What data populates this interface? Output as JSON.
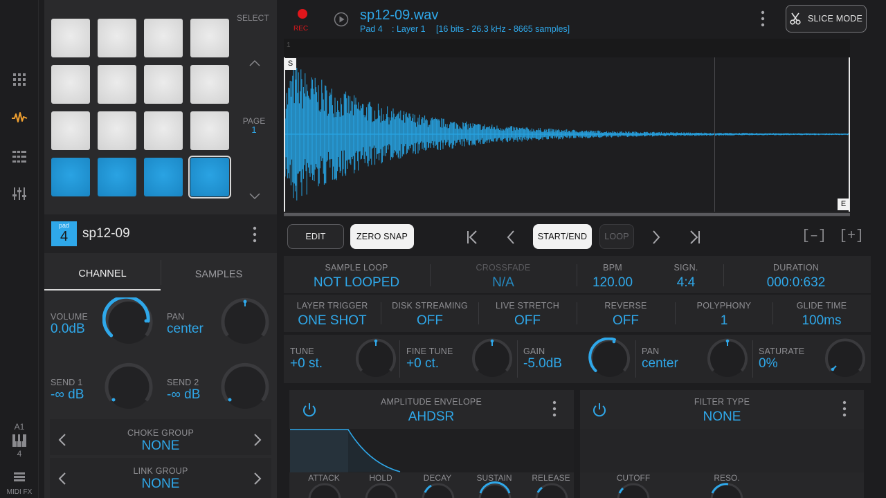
{
  "header": {
    "rec_label": "REC",
    "file_name": "sp12-09.wav",
    "pad_info": "Pad 4",
    "layer_info": ": Layer 1",
    "sample_info": "[16 bits - 26.3 kHz - 8665 samples]",
    "slice_mode_label": "SLICE MODE"
  },
  "pad_grid": {
    "select_label": "SELECT",
    "page_label": "PAGE",
    "page_number": "1",
    "pad_badge_label": "pad",
    "pad_badge_number": "4",
    "pad_name": "sp12-09"
  },
  "channel_tabs": {
    "channel": "CHANNEL",
    "samples": "SAMPLES"
  },
  "channel": {
    "volume_label": "VOLUME",
    "volume_value": "0.0dB",
    "pan_label": "PAN",
    "pan_value": "center",
    "send1_label": "SEND 1",
    "send1_value": "-∞ dB",
    "send2_label": "SEND 2",
    "send2_value": "-∞ dB",
    "choke_label": "CHOKE GROUP",
    "choke_value": "NONE",
    "link_label": "LINK GROUP",
    "link_value": "NONE"
  },
  "leftnav": {
    "track_label": "A1",
    "track_number": "4",
    "midi_fx": "MIDI FX"
  },
  "waveform": {
    "ruler_mark": "1",
    "start_marker": "S",
    "end_marker": "E"
  },
  "toolbar": {
    "edit": "EDIT",
    "zero_snap": "ZERO SNAP",
    "start_end": "START/END",
    "loop": "LOOP",
    "zoom_out": "[–]",
    "zoom_in": "[+]"
  },
  "params_row1": {
    "sample_loop_label": "SAMPLE LOOP",
    "sample_loop_value": "NOT LOOPED",
    "crossfade_label": "CROSSFADE",
    "crossfade_value": "N/A",
    "bpm_label": "BPM",
    "bpm_value": "120.00",
    "sign_label": "SIGN.",
    "sign_value": "4:4",
    "duration_label": "DURATION",
    "duration_value": "000:0:632"
  },
  "params_row2": {
    "layer_trigger_label": "LAYER TRIGGER",
    "layer_trigger_value": "ONE SHOT",
    "disk_streaming_label": "DISK STREAMING",
    "disk_streaming_value": "OFF",
    "live_stretch_label": "LIVE STRETCH",
    "live_stretch_value": "OFF",
    "reverse_label": "REVERSE",
    "reverse_value": "OFF",
    "polyphony_label": "POLYPHONY",
    "polyphony_value": "1",
    "glide_label": "GLIDE TIME",
    "glide_value": "100ms"
  },
  "params_row3": {
    "tune_label": "TUNE",
    "tune_value": "+0 st.",
    "fine_label": "FINE TUNE",
    "fine_value": "+0 ct.",
    "gain_label": "GAIN",
    "gain_value": "-5.0dB",
    "pan_label": "PAN",
    "pan_value": "center",
    "saturate_label": "SATURATE",
    "saturate_value": "0%"
  },
  "envelope": {
    "title": "AMPLITUDE ENVELOPE",
    "value": "AHDSR",
    "attack": "ATTACK",
    "hold": "HOLD",
    "decay": "DECAY",
    "sustain": "SUSTAIN",
    "release": "RELEASE"
  },
  "filter": {
    "title": "FILTER TYPE",
    "value": "NONE",
    "cutoff": "CUTOFF",
    "reso": "RESO."
  },
  "colors": {
    "accent": "#2fa8ea",
    "pad_blue": "#1a86c4",
    "waveform": "#27a4e4",
    "rec": "#e0161b",
    "nav_active": "#f0a030"
  }
}
